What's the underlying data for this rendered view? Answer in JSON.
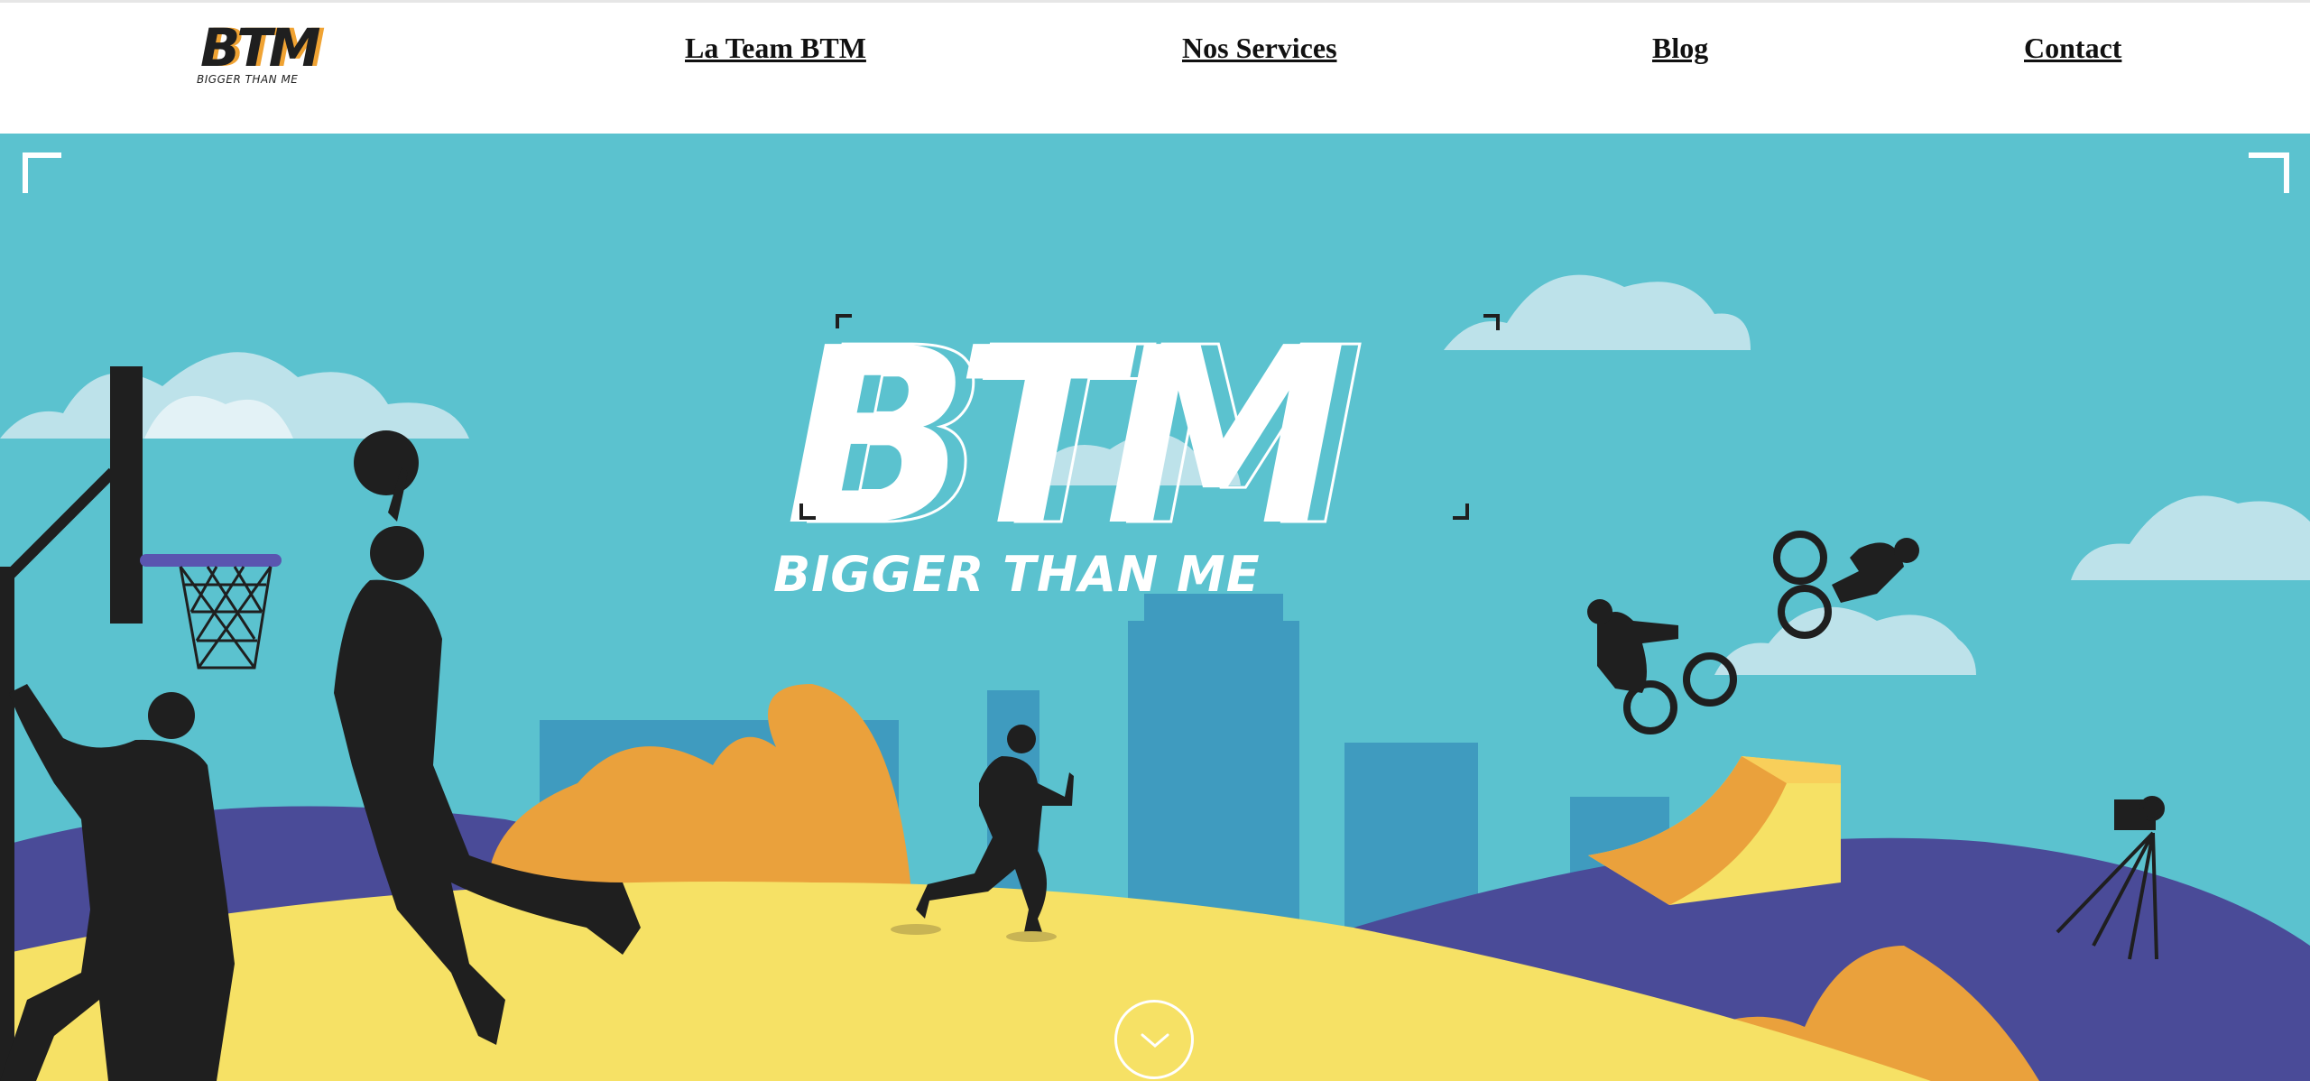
{
  "brand": {
    "logo_text": "BTM",
    "logo_tagline": "BIGGER THAN ME"
  },
  "nav": {
    "items": [
      {
        "label": "La Team BTM"
      },
      {
        "label": "Nos Services"
      },
      {
        "label": "Blog"
      },
      {
        "label": "Contact"
      }
    ]
  },
  "hero": {
    "title": "BTM",
    "subtitle": "BIGGER THAN ME",
    "scroll_icon": "chevron-down-icon"
  },
  "colors": {
    "sky": "#5bc2cf",
    "cloud": "#bde2ea",
    "city": "#3f9bbf",
    "hill_purple": "#4a4b98",
    "ground_yellow": "#f6e165",
    "bush_orange": "#eaa13c",
    "silhouette": "#1f1f1f",
    "accent_orange": "#f0a333"
  }
}
